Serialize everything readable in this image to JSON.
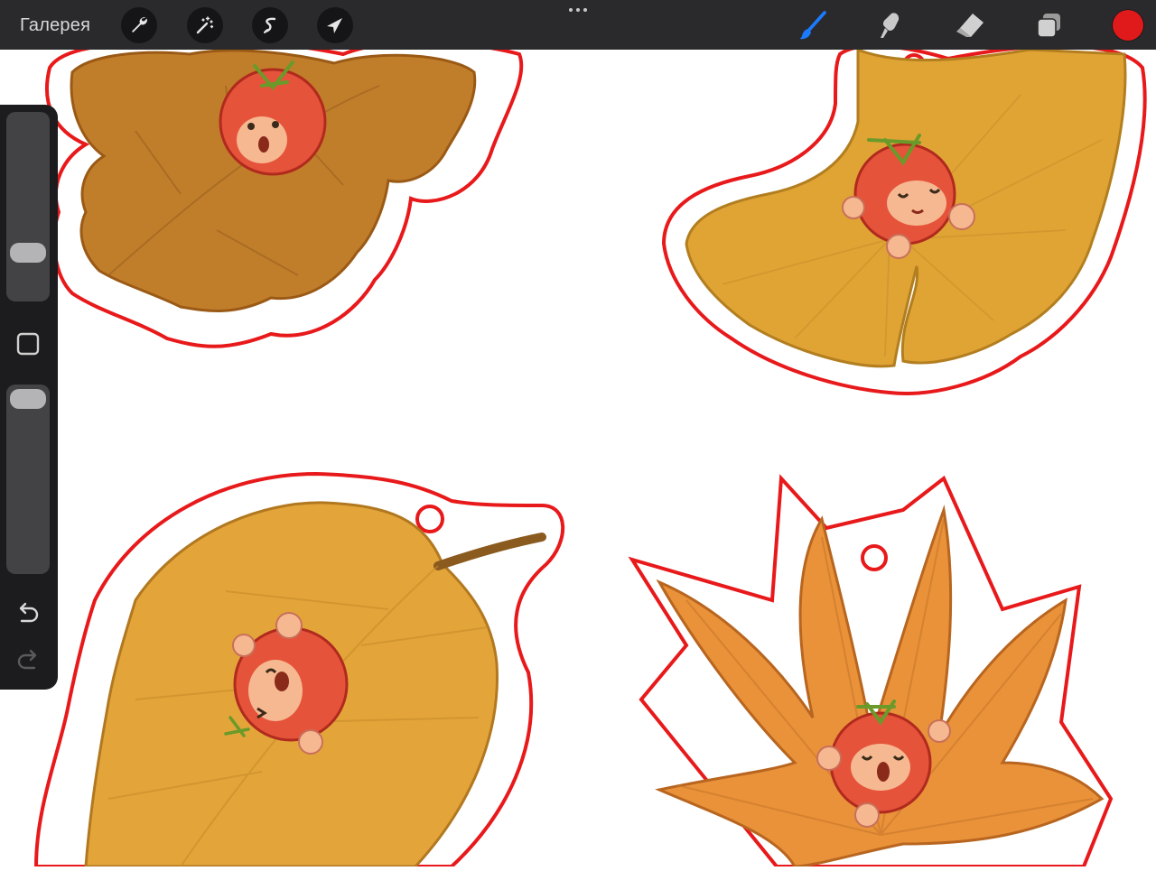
{
  "toolbar": {
    "gallery_label": "Галерея",
    "left_tools": [
      {
        "name": "wrench-icon",
        "action": "actions"
      },
      {
        "name": "magic-wand-icon",
        "action": "adjustments"
      },
      {
        "name": "selection-s-icon",
        "action": "selection"
      },
      {
        "name": "arrow-cursor-icon",
        "action": "transform"
      }
    ],
    "right_tools": [
      {
        "name": "brush-icon",
        "active": true
      },
      {
        "name": "smudge-icon",
        "active": false
      },
      {
        "name": "eraser-icon",
        "active": false
      },
      {
        "name": "layers-icon",
        "active": false
      }
    ],
    "active_tool_color": "#1a7bff",
    "current_color": "#e01a1a"
  },
  "sidebar": {
    "brush_size_level": 0.74,
    "opacity_level": 1.0,
    "icons": [
      "square-modify-icon",
      "undo-icon",
      "redo-icon"
    ]
  },
  "artwork": {
    "stickers": [
      {
        "name": "oak-leaf-sticker",
        "leaf_color": "#c17e2a",
        "outline_color": "#e8191b"
      },
      {
        "name": "ginkgo-leaf-sticker",
        "leaf_color": "#e0a435",
        "outline_color": "#e8191b"
      },
      {
        "name": "birch-leaf-sticker",
        "leaf_color": "#e3a53a",
        "outline_color": "#e8191b"
      },
      {
        "name": "maple-leaf-sticker",
        "leaf_color": "#e9923a",
        "outline_color": "#e8191b"
      }
    ]
  }
}
